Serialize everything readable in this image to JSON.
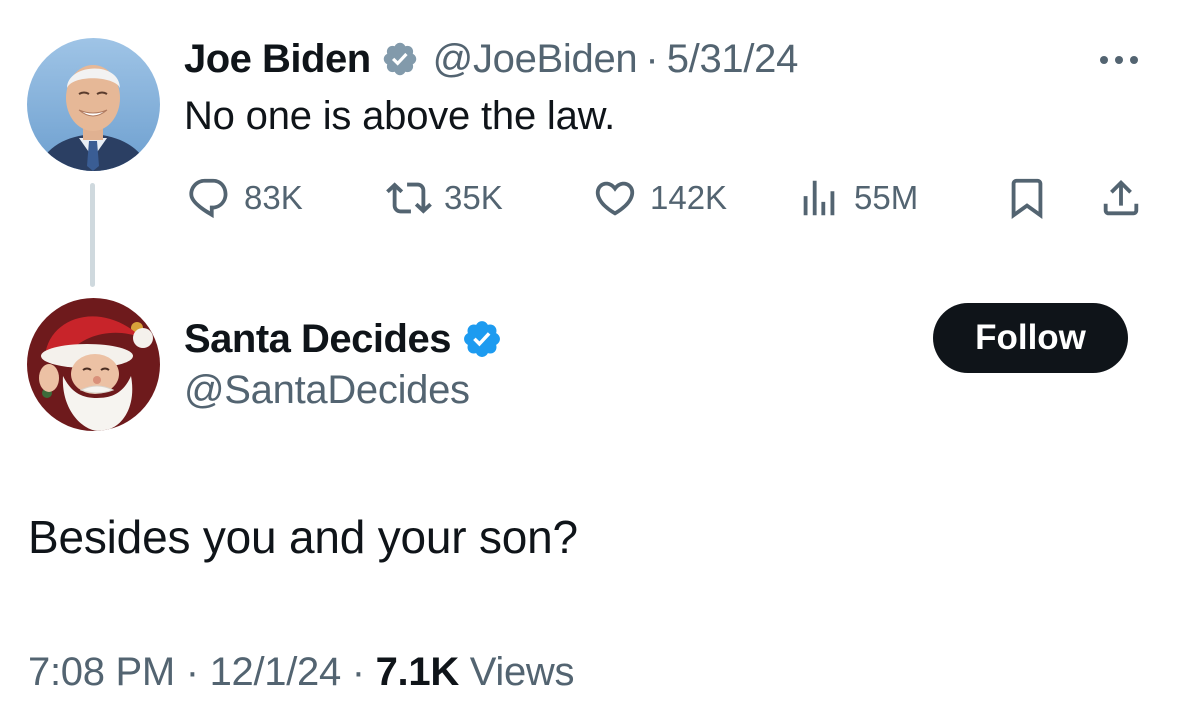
{
  "parent_tweet": {
    "author_name": "Joe Biden",
    "handle": "@JoeBiden",
    "separator": "·",
    "date": "5/31/24",
    "text": "No one is above the law.",
    "verified_badge_icon": "gov-checkmark-icon",
    "actions": {
      "replies": "83K",
      "reposts": "35K",
      "likes": "142K",
      "views": "55M"
    }
  },
  "reply_tweet": {
    "author_name": "Santa Decides",
    "handle": "@SantaDecides",
    "verified_badge_icon": "blue-checkmark-icon",
    "follow_label": "Follow",
    "text": "Besides you and your son?",
    "time": "7:08 PM",
    "separator": "·",
    "date": "12/1/24",
    "views_count": "7.1K",
    "views_label": "Views"
  },
  "colors": {
    "text_primary": "#0f1419",
    "text_secondary": "#536471",
    "verified_blue": "#1d9bf0",
    "gov_badge_gray": "#829aab",
    "thread_line": "#cfd9de"
  }
}
